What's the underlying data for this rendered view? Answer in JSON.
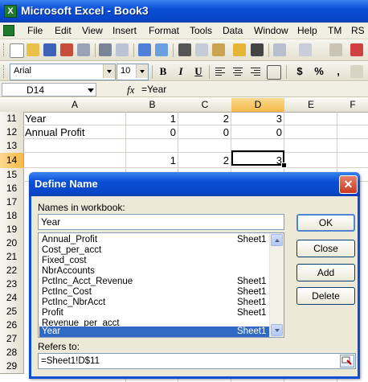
{
  "window": {
    "title": "Microsoft Excel - Book3"
  },
  "menu": {
    "items": [
      "File",
      "Edit",
      "View",
      "Insert",
      "Format",
      "Tools",
      "Data",
      "Window",
      "Help",
      "TM",
      "RS"
    ]
  },
  "format_toolbar": {
    "font": "Arial",
    "size": "10",
    "bold": "B",
    "italic": "I",
    "underline": "U",
    "currency": "$",
    "percent": "%",
    "comma": ","
  },
  "formula_bar": {
    "name_box": "D14",
    "fx": "fx",
    "formula": "=Year"
  },
  "grid": {
    "columns": [
      "A",
      "B",
      "C",
      "D",
      "E",
      "F"
    ],
    "rows": [
      "11",
      "12",
      "13",
      "14",
      "15",
      "16",
      "17",
      "18",
      "19",
      "20",
      "21",
      "22",
      "23",
      "24",
      "25",
      "26",
      "27",
      "28",
      "29"
    ],
    "active_cell": "D14",
    "cells": {
      "a11": "Year",
      "b11": "1",
      "c11": "2",
      "d11": "3",
      "a12": "Annual Profit",
      "b12": "0",
      "c12": "0",
      "d12": "0",
      "b14": "1",
      "c14": "2",
      "d14": "3"
    }
  },
  "dialog": {
    "title": "Define Name",
    "close": "✕",
    "names_label": "Names in workbook:",
    "names_value": "Year",
    "names": [
      {
        "name": "Annual_Profit",
        "sheet": "Sheet1"
      },
      {
        "name": "Cost_per_acct",
        "sheet": ""
      },
      {
        "name": "Fixed_cost",
        "sheet": ""
      },
      {
        "name": "NbrAccounts",
        "sheet": ""
      },
      {
        "name": "PctInc_Acct_Revenue",
        "sheet": "Sheet1"
      },
      {
        "name": "PctInc_Cost",
        "sheet": "Sheet1"
      },
      {
        "name": "PctInc_NbrAcct",
        "sheet": "Sheet1"
      },
      {
        "name": "Profit",
        "sheet": "Sheet1"
      },
      {
        "name": "Revenue_per_acct",
        "sheet": ""
      },
      {
        "name": "Year",
        "sheet": "Sheet1"
      }
    ],
    "selected_index": 9,
    "buttons": {
      "ok": "OK",
      "close": "Close",
      "add": "Add",
      "delete": "Delete"
    },
    "refers_label": "Refers to:",
    "refers_value": "=Sheet1!D$11"
  },
  "colors": {
    "titlebar": "#0a4fd6",
    "selection": "#316ac5",
    "header_selected": "#f6b949"
  }
}
